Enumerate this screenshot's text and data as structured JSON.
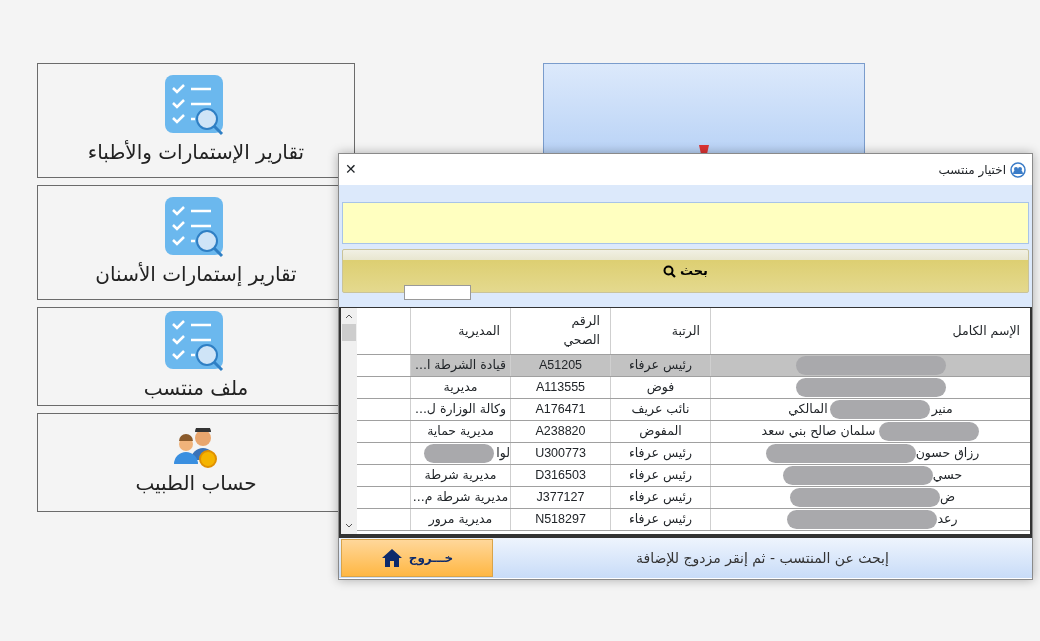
{
  "tiles": [
    {
      "label": "تقارير الإستمارات والأطباء",
      "kind": "checklist"
    },
    {
      "label": "تقارير إستمارات الأسنان",
      "kind": "checklist"
    },
    {
      "label": "ملف منتسب",
      "kind": "checklist"
    },
    {
      "label": "حساب الطبيب",
      "kind": "people"
    }
  ],
  "dialog": {
    "title": "اختيار منتسب",
    "close_glyph": "✕",
    "search_button": "بحث",
    "table": {
      "columns": [
        "الإسم الكامل",
        "الرتبة",
        "الرقم الصحي",
        "المديرية"
      ],
      "rows": [
        {
          "kind": "full",
          "rank": "رئيس عرفاء",
          "number": "A51205",
          "directorate": "قيادة الشرطة ا...",
          "selected": true
        },
        {
          "kind": "full",
          "rank": "فوض",
          "number": "A113555",
          "directorate": "مديرية",
          "selected": false
        },
        {
          "name": [
            "منير",
            "المالكي"
          ],
          "kind": "middle",
          "rank": "نائب عريف",
          "number": "A176471",
          "directorate": "وكالة الوزارة ل...",
          "selected": false
        },
        {
          "name": [
            "سلمان صالح بني سعد"
          ],
          "kind": "start",
          "rank": "المفوض",
          "number": "A238820",
          "directorate": "مديرية حماية",
          "selected": false
        },
        {
          "name": [
            "رزاق حسون"
          ],
          "kind": "end",
          "rank": "رئيس عرفاء",
          "number": "U300773",
          "directorate": "لوا",
          "directorate_redacted": true,
          "selected": false
        },
        {
          "name": [
            "حسي"
          ],
          "kind": "end",
          "rank": "رئيس عرفاء",
          "number": "D316503",
          "directorate": "مديرية شرطة",
          "selected": false
        },
        {
          "name": [
            "ض"
          ],
          "kind": "end",
          "rank": "رئيس عرفاء",
          "number": "J377127",
          "directorate": "مديرية شرطة م...",
          "selected": false
        },
        {
          "name": [
            "رعد"
          ],
          "kind": "end",
          "rank": "رئيس عرفاء",
          "number": "N518297",
          "directorate": "مديرية مرور",
          "selected": false
        }
      ]
    },
    "status_text": "إبحث عن المنتسب - ثم إنقر مزدوج للإضافة",
    "exit_button": "خـــروج"
  }
}
